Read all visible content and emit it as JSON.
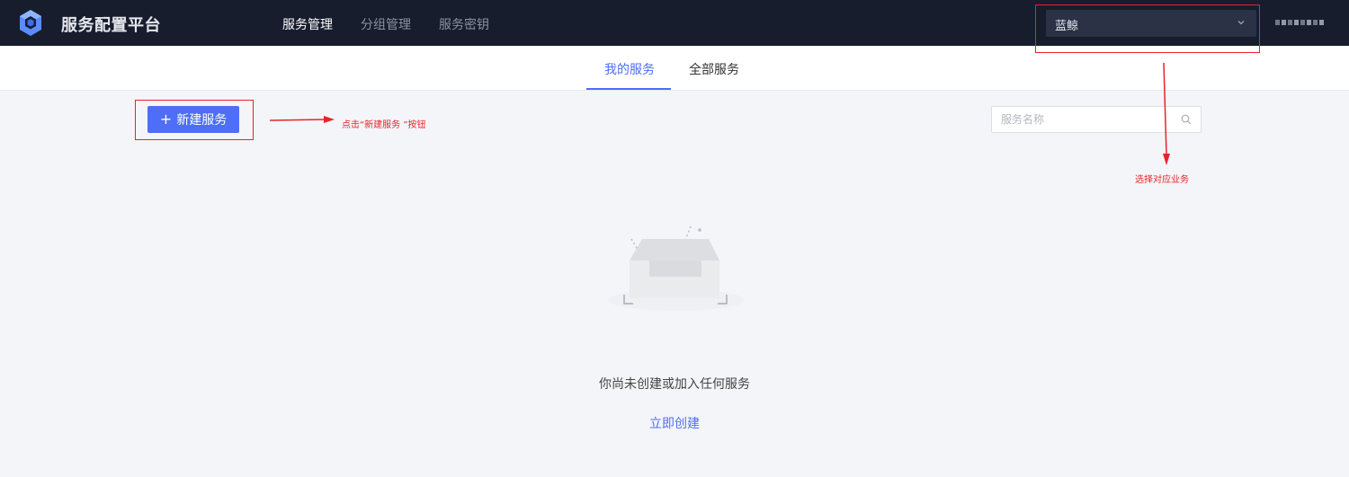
{
  "header": {
    "app_title": "服务配置平台",
    "logo_icon": "hexagon-cube-icon",
    "nav": [
      {
        "label": "服务管理",
        "active": true
      },
      {
        "label": "分组管理",
        "active": false
      },
      {
        "label": "服务密钥",
        "active": false
      }
    ],
    "business_select": {
      "value": "蓝鲸",
      "icon": "chevron-down-icon"
    }
  },
  "tabs": [
    {
      "label": "我的服务",
      "active": true
    },
    {
      "label": "全部服务",
      "active": false
    }
  ],
  "toolbar": {
    "create_button": {
      "icon": "plus-icon",
      "label": "新建服务"
    },
    "search": {
      "placeholder": "服务名称",
      "value": "",
      "icon": "search-icon"
    }
  },
  "annotations": {
    "create_hint": "点击“新建服务 ”按钮",
    "select_hint": "选择对应业务",
    "color": "#e8232a"
  },
  "empty_state": {
    "message": "你尚未创建或加入任何服务",
    "action": "立即创建",
    "icon": "empty-inbox-icon"
  },
  "colors": {
    "header_bg": "#171d2d",
    "accent": "#4f6ef7",
    "page_bg": "#f4f5f8"
  }
}
